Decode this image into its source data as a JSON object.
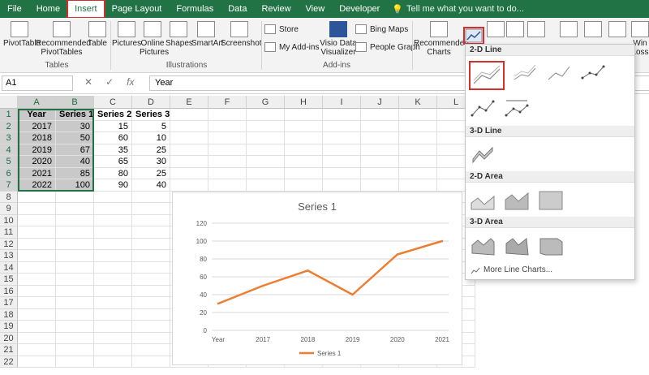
{
  "tabs": [
    "File",
    "Home",
    "Insert",
    "Page Layout",
    "Formulas",
    "Data",
    "Review",
    "View",
    "Developer"
  ],
  "active_tab": "Insert",
  "tell_me": "Tell me what you want to do...",
  "ribbon": {
    "pivot": "PivotTable",
    "recommended_pivot_1": "Recommended",
    "recommended_pivot_2": "PivotTables",
    "table": "Table",
    "group_tables": "Tables",
    "pictures": "Pictures",
    "online_pictures_1": "Online",
    "online_pictures_2": "Pictures",
    "shapes": "Shapes",
    "smartart": "SmartArt",
    "screenshot": "Screenshot",
    "group_illustrations": "Illustrations",
    "store": "Store",
    "my_addins": "My Add-ins",
    "visio_1": "Visio Data",
    "visio_2": "Visualizer",
    "bing_maps": "Bing Maps",
    "people_graph": "People Graph",
    "group_addins": "Add-ins",
    "recommended_charts_1": "Recommended",
    "recommended_charts_2": "Charts",
    "win_1": "Win",
    "win_2": "Loss"
  },
  "formula_bar": {
    "name_box": "A1",
    "fx": "fx",
    "value": "Year"
  },
  "columns": [
    "A",
    "B",
    "C",
    "D",
    "E",
    "F",
    "G",
    "H",
    "I",
    "J",
    "K",
    "L"
  ],
  "rows": [
    "1",
    "2",
    "3",
    "4",
    "5",
    "6",
    "7",
    "8",
    "9",
    "10",
    "11",
    "12",
    "13",
    "14",
    "15",
    "16",
    "17",
    "18",
    "19",
    "20",
    "21",
    "22"
  ],
  "table": {
    "headers": [
      "Year",
      "Series 1",
      "Series 2",
      "Series 3"
    ],
    "data": [
      [
        "2017",
        "30",
        "15",
        "5"
      ],
      [
        "2018",
        "50",
        "60",
        "10"
      ],
      [
        "2019",
        "67",
        "35",
        "25"
      ],
      [
        "2020",
        "40",
        "65",
        "30"
      ],
      [
        "2021",
        "85",
        "80",
        "25"
      ],
      [
        "2022",
        "100",
        "90",
        "40"
      ]
    ]
  },
  "dropdown": {
    "sec_2d_line": "2-D Line",
    "sec_3d_line": "3-D Line",
    "sec_2d_area": "2-D Area",
    "sec_3d_area": "3-D Area",
    "more": "More Line Charts..."
  },
  "chart_data": {
    "type": "line",
    "title": "Series 1",
    "categories": [
      "Year",
      "2017",
      "2018",
      "2019",
      "2020",
      "2021"
    ],
    "series": [
      {
        "name": "Series 1",
        "values": [
          30,
          50,
          67,
          40,
          85,
          100
        ]
      }
    ],
    "yticks": [
      "0",
      "20",
      "40",
      "60",
      "80",
      "100",
      "120"
    ],
    "ylim": [
      0,
      120
    ],
    "color": "#ED7D31",
    "grid": true,
    "legend": "bottom"
  }
}
